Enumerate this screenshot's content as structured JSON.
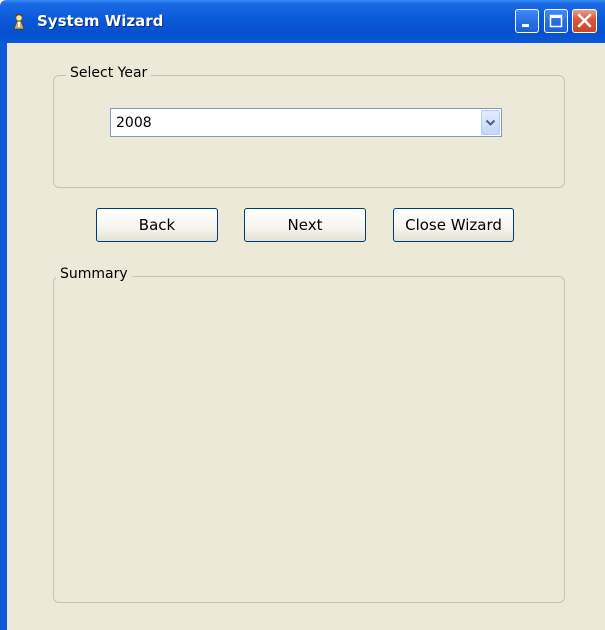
{
  "window": {
    "title": "System Wizard",
    "title_color": "#0a5ad8",
    "icons": {
      "app": "wizard-app-icon",
      "minimize": "minimize-icon",
      "maximize": "maximize-icon",
      "close": "close-icon"
    }
  },
  "year_group": {
    "legend": "Select Year",
    "year_select": {
      "value": "2008",
      "arrow_icon": "chevron-down-icon"
    }
  },
  "buttons": {
    "back": "Back",
    "next": "Next",
    "close_wizard": "Close Wizard"
  },
  "summary_group": {
    "legend": "Summary"
  },
  "colors": {
    "titlebar": "#0a5ad8",
    "client_bg": "#ece9d8",
    "close_button": "#d9593b"
  }
}
